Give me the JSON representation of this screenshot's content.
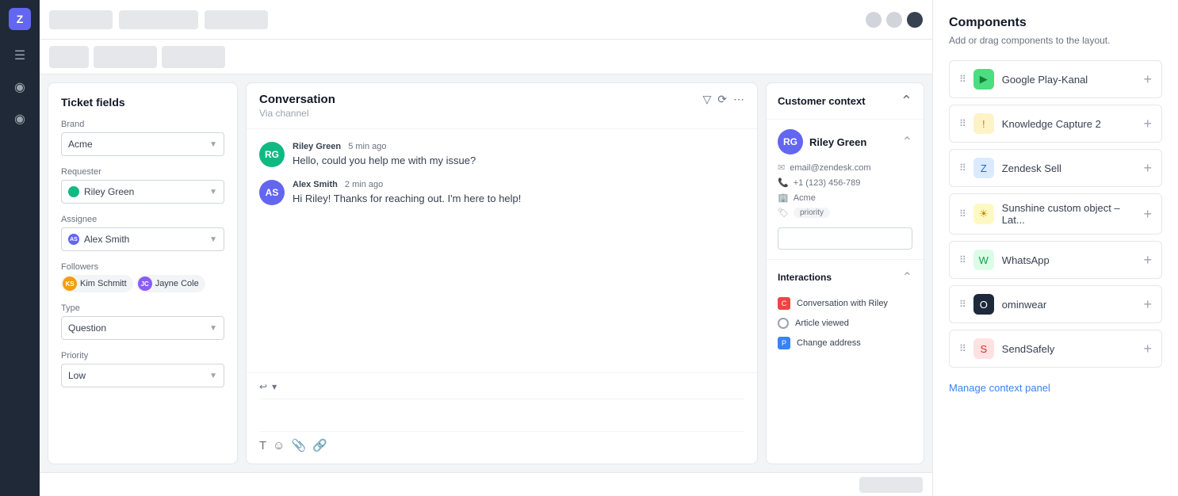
{
  "nav": {
    "logo_text": "Z",
    "icons": [
      "☰",
      "◎",
      "◎"
    ]
  },
  "top_bar": {
    "tab_widths": [
      80,
      100,
      80
    ],
    "circles": 3
  },
  "sub_bar": {
    "buttons": [
      50,
      80,
      80
    ]
  },
  "ticket_fields": {
    "title": "Ticket fields",
    "brand_label": "Brand",
    "brand_value": "Acme",
    "requester_label": "Requester",
    "requester_value": "Riley Green",
    "assignee_label": "Assignee",
    "assignee_value": "Alex Smith",
    "followers_label": "Followers",
    "followers": [
      {
        "name": "Kim Schmitt",
        "initials": "KS",
        "color": "#f59e0b"
      },
      {
        "name": "Jayne Cole",
        "initials": "JC",
        "color": "#8b5cf6"
      }
    ],
    "type_label": "Type",
    "type_value": "Question",
    "priority_label": "Priority",
    "priority_value": "Low"
  },
  "conversation": {
    "title": "Conversation",
    "subtitle": "Via channel",
    "messages": [
      {
        "sender": "Riley Green",
        "time": "5 min ago",
        "text": "Hello, could you help me with my issue?",
        "initials": "RG",
        "color": "#10b981"
      },
      {
        "sender": "Alex Smith",
        "time": "2 min ago",
        "text": "Hi Riley! Thanks for reaching out. I'm here to help!",
        "initials": "AS",
        "color": "#6366f1"
      }
    ],
    "toolbar_icons": [
      "T",
      "☺",
      "📎",
      "🔗"
    ]
  },
  "customer_context": {
    "title": "Customer context",
    "customer_name": "Riley Green",
    "customer_initials": "RG",
    "email": "email@zendesk.com",
    "phone": "+1 (123) 456-789",
    "company": "Acme",
    "tag": "priority",
    "interactions_title": "Interactions",
    "interactions": [
      {
        "label": "Conversation with Riley",
        "icon_color": "#ef4444",
        "icon_text": "C"
      },
      {
        "label": "Article viewed",
        "icon_color": "#9ca3af",
        "icon_text": "○"
      },
      {
        "label": "Change address",
        "icon_color": "#3b82f6",
        "icon_text": "P"
      }
    ]
  },
  "components": {
    "title": "Components",
    "subtitle": "Add or drag components to the layout.",
    "manage_link": "Manage context panel",
    "items": [
      {
        "label": "Google Play-Kanal",
        "icon_bg": "#4ade80",
        "icon_text": "▶",
        "icon_color": "#15803d"
      },
      {
        "label": "Knowledge Capture 2",
        "icon_bg": "#fef3c7",
        "icon_text": "!",
        "icon_color": "#d97706"
      },
      {
        "label": "Zendesk Sell",
        "icon_bg": "#dbeafe",
        "icon_text": "Z",
        "icon_color": "#2563eb"
      },
      {
        "label": "Sunshine custom object – Lat...",
        "icon_bg": "#fef9c3",
        "icon_text": "☀",
        "icon_color": "#ca8a04"
      },
      {
        "label": "WhatsApp",
        "icon_bg": "#dcfce7",
        "icon_text": "W",
        "icon_color": "#16a34a"
      },
      {
        "label": "ominwear",
        "icon_bg": "#1e293b",
        "icon_text": "O",
        "icon_color": "white"
      },
      {
        "label": "SendSafely",
        "icon_bg": "#fee2e2",
        "icon_text": "S",
        "icon_color": "#dc2626"
      }
    ]
  }
}
